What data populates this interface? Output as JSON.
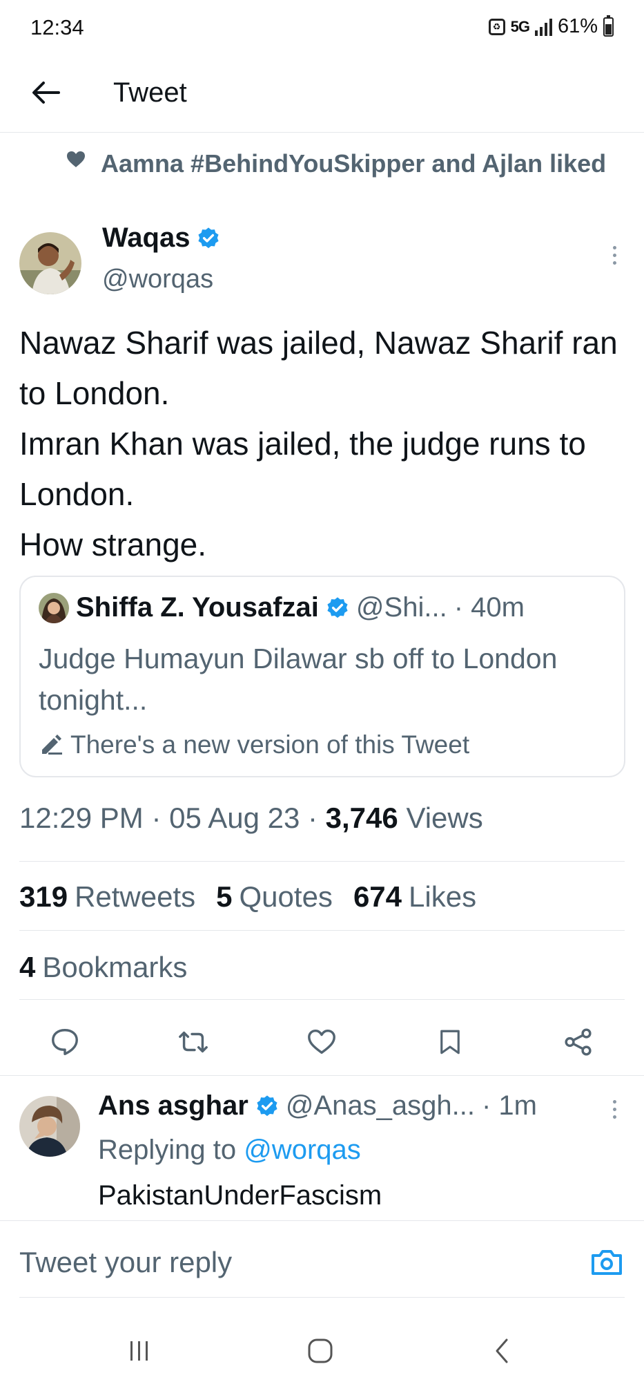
{
  "status_bar": {
    "time": "12:34",
    "network": "5G",
    "battery": "61%"
  },
  "header": {
    "title": "Tweet"
  },
  "liked_by": "Aamna #BehindYouSkipper and Ajlan liked",
  "tweet": {
    "author_name": "Waqas",
    "author_handle": "@worqas",
    "text": "Nawaz Sharif was jailed, Nawaz Sharif ran to London.\nImran Khan was jailed, the judge runs to London.\nHow strange.",
    "quote": {
      "author_name": "Shiffa Z. Yousafzai",
      "author_handle": "@Shi...",
      "age": "· 40m",
      "text": "Judge Humayun Dilawar sb off to London tonight...",
      "notice": "There's a new version of this Tweet"
    },
    "time": "12:29 PM",
    "date": "05 Aug 23",
    "views_count": "3,746",
    "views_label": "Views",
    "separator": "·",
    "retweets_count": "319",
    "retweets_label": "Retweets",
    "quotes_count": "5",
    "quotes_label": "Quotes",
    "likes_count": "674",
    "likes_label": "Likes",
    "bookmarks_count": "4",
    "bookmarks_label": "Bookmarks"
  },
  "reply": {
    "author_name": "Ans asghar",
    "author_handle": "@Anas_asgh...",
    "age": "· 1m",
    "replying_prefix": "Replying to",
    "replying_handle": "@worqas",
    "text": "PakistanUnderFascism"
  },
  "composer": {
    "placeholder": "Tweet your reply"
  },
  "colors": {
    "accent": "#1d9bf0",
    "muted": "#536471",
    "text": "#0f1419",
    "border": "#e5e7eb"
  },
  "icons": [
    "back-arrow-icon",
    "heart-icon",
    "verified-icon",
    "more-icon",
    "edit-icon",
    "reply-icon",
    "retweet-icon",
    "bookmark-icon",
    "share-icon",
    "camera-icon",
    "recents-icon",
    "home-icon",
    "back-icon"
  ]
}
